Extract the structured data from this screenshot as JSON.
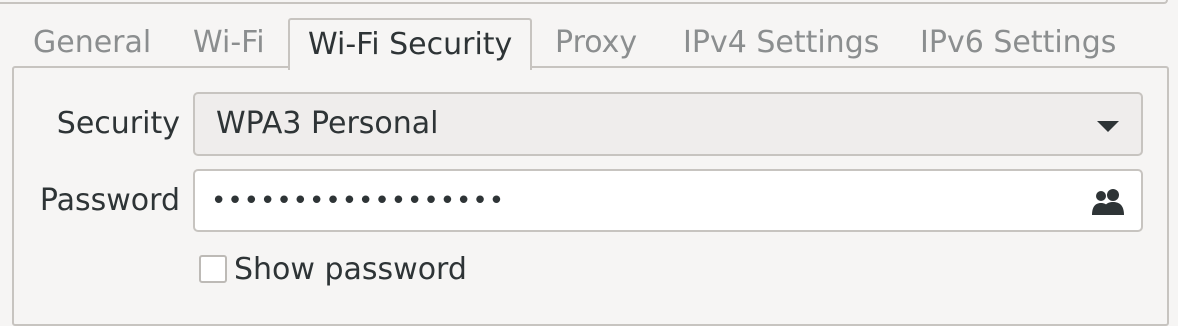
{
  "tabs": [
    {
      "label": "General",
      "active": false
    },
    {
      "label": "Wi-Fi",
      "active": false
    },
    {
      "label": "Wi-Fi Security",
      "active": true
    },
    {
      "label": "Proxy",
      "active": false
    },
    {
      "label": "IPv4 Settings",
      "active": false
    },
    {
      "label": "IPv6 Settings",
      "active": false
    }
  ],
  "security": {
    "label": "Security",
    "selected": "WPA3 Personal"
  },
  "password": {
    "label": "Password",
    "masked_value": "••••••••••••••••••",
    "icon": "people-icon"
  },
  "show_password": {
    "label": "Show password",
    "checked": false
  },
  "colors": {
    "background": "#f6f5f4",
    "border": "#c7c4c0",
    "text": "#2e3436",
    "inactive_tab_text": "#8b8e8f"
  }
}
